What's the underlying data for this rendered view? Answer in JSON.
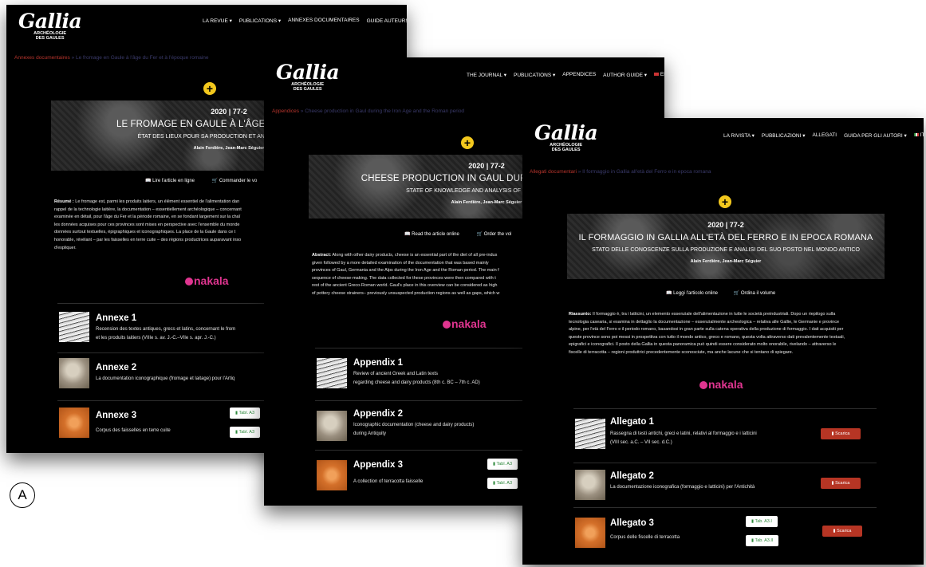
{
  "panel_label": "A",
  "icons": [
    "book-icon",
    "cart-icon",
    "file-icon",
    "plus-icon",
    "flag-icon"
  ],
  "colors": {
    "accent_yellow": "#f3c81d",
    "download_red": "#b63524",
    "nakala_pink": "#e03590",
    "crumb_red": "#b8352d"
  },
  "fr": {
    "logo": {
      "name": "Gallia",
      "sub1": "ARCHÉOLOGIE",
      "sub2": "DES GAULES"
    },
    "nav": [
      "LA REVUE ▾",
      "PUBLICATIONS ▾",
      "ANNEXES DOCUMENTAIRES",
      "GUIDE AUTEURS ▾"
    ],
    "breadcrumb": {
      "root": "Annexes documentaires",
      "current": "» Le fromage en Gaule à l'âge du Fer et à l'époque romaine"
    },
    "hero": {
      "year": "2020 | 77-2",
      "title": "LE FROMAGE EN GAULE À L'ÂGE DU FER ET À L'É",
      "subtitle": "ÉTAT DES LIEUX POUR SA PRODUCTION ET ANALYSE DE SA PLACE",
      "authors": "Alain Ferdière, Jean-Marc Séguier"
    },
    "links": {
      "read": "Lire l'article en ligne",
      "order": "Commander le vo"
    },
    "abstract": {
      "label": "Résumé :",
      "lines": [
        "Le fromage est, parmi les produits laitiers, un élément essentiel de l'alimentation dan",
        "rappel de la technologie laitière, la documentation – essentiellement archéologique – concernant",
        "examinée en détail, pour l'âge du Fer et la période romaine, en se fondant largement sur la chaî",
        "les données acquises pour ces provinces sont mises en perspective avec l'ensemble du monde",
        "données surtout textuelles, épigraphiques et iconographiques. La place de la Gaule dans ce t",
        "honorable, révélant – par les faisselles en terre cuite – des régions productrices auparavant inso",
        "d'expliquer."
      ]
    },
    "nakala": "nakala",
    "rows": [
      {
        "title": "Annexe 1",
        "desc1": "Recension des textes antiques, grecs et latins, concernant le from",
        "desc2": "et les produits laitiers (VIIIe s. av. J.-C.–VIIe s. apr. J.-C.)"
      },
      {
        "title": "Annexe 2",
        "desc1": "La documentation iconographique (fromage et laitage) pour l'Artiq",
        "desc2": ""
      },
      {
        "title": "Annexe 3",
        "desc1": "Corpus des faisselles en terre cuite",
        "desc2": "",
        "btn1": "Tabl. A3",
        "btn2": "Tabl. A3"
      }
    ]
  },
  "en": {
    "logo": {
      "name": "Gallia",
      "sub1": "ARCHÉOLOGIE",
      "sub2": "DES GAULES"
    },
    "nav": [
      "THE JOURNAL ▾",
      "PUBLICATIONS ▾",
      "APPENDICES",
      "AUTHOR GUIDE ▾",
      "EN"
    ],
    "breadcrumb": {
      "root": "Appendices",
      "current": "» Cheese production in Gaul during the Iron Age and the Roman period"
    },
    "hero": {
      "year": "2020 | 77-2",
      "title": "CHEESE PRODUCTION IN GAUL DURING THE IRON AGE",
      "subtitle": "STATE OF KNOWLEDGE AND ANALYSIS OF ITS PLACE IN TH",
      "authors": "Alain Ferdière, Jean-Marc Séguier"
    },
    "links": {
      "read": "Read the article online",
      "order": "Order the vol"
    },
    "abstract": {
      "label": "Abstract:",
      "lines": [
        "Along with other dairy products, cheese is an essential part of the diet of all pre-indus",
        "given followed by a more detailed examination of the documentation that was based mainly",
        "provinces of Gaul, Germania and the Alps during the Iron Age and the Roman period. The main f",
        "sequence of cheese-making. The data collected for these provinces were then compared with t",
        "rest of the ancient Greco-Roman world. Gaul's place in this overview can be considered as high",
        "of pottery cheese strainers– previously unsuspected production regions as well as gaps, which w"
      ]
    },
    "nakala": "nakala",
    "rows": [
      {
        "title": "Appendix 1",
        "desc1": "Review of ancient Greek and Latin texts",
        "desc2": "regarding cheese and dairy products (8th c. BC – 7th c. AD)"
      },
      {
        "title": "Appendix 2",
        "desc1": "Iconographic documentation (cheese and dairy products)",
        "desc2": "during Antiquity"
      },
      {
        "title": "Appendix 3",
        "desc1": "A collection of terracotta faisselle",
        "desc2": "",
        "btn1": "Tabl. A3",
        "btn2": "Tabl. A3"
      }
    ]
  },
  "it": {
    "logo": {
      "name": "Gallia",
      "sub1": "ARCHÉOLOGIE",
      "sub2": "DES GAULES"
    },
    "nav": [
      "LA RIVISTA ▾",
      "PUBBLICAZIONI ▾",
      "ALLEGATI",
      "GUIDA PER GLI AUTORI ▾",
      "IT"
    ],
    "breadcrumb": {
      "root": "Allegati documentari",
      "current": "» Il formaggio in Gallia all'età del Ferro e in epoca romana"
    },
    "hero": {
      "year": "2020 | 77-2",
      "title": "IL FORMAGGIO IN GALLIA ALL'ETÀ DEL FERRO E IN EPOCA ROMANA",
      "subtitle": "STATO DELLE CONOSCENZE SULLA PRODUZIONE E ANALISI DEL SUO POSTO NEL MONDO ANTICO",
      "authors": "Alain Ferdière, Jean-Marc Séguier"
    },
    "links": {
      "read": "Leggi l'articolo online",
      "order": "Ordina il volume"
    },
    "abstract": {
      "label": "Riassunto:",
      "lines": [
        "Il formaggio è, tra i latticini, un elemento essenziale dell'alimentazione in tutte le società preindustriali. Dopo un riepilogo sulla",
        "tecnologia casearia, si esamina in dettaglio la documentazione – essenzialmente archeologica – relativa alle Gallie, le Germanie e province",
        "alpine, per l'età del Ferro e il periodo romano, basandosi in gran parte sulla catena operativa della produzione di formaggio. I dati acquisiti per",
        "queste province sono poi messi in prospettiva con tutto il mondo antico, greco e romano, questa volta attraverso dati prevalentemente testuali,",
        "epigrafici e iconografici. Il posto della Gallia in questa panoramica può quindi essere considerato molto onorabile, rivelando – attraverso le",
        "fiscelle di terracotta – regioni produttrici precedentemente sconosciute, ma anche lacune che si tentano di spiegare."
      ]
    },
    "nakala": "nakala",
    "rows": [
      {
        "title": "Allegato 1",
        "desc1": "Rassegna di testi antichi, greci e latini, relativi al formaggio e i latticini",
        "desc2": "(VIII sec. a.C. – VII sec. d.C.)",
        "btn": "Scarica"
      },
      {
        "title": "Allegato 2",
        "desc1": "La documentazione iconografica (formaggio e latticini) per l'Antichità",
        "desc2": "",
        "btn": "Scarica"
      },
      {
        "title": "Allegato 3",
        "desc1": "Corpus delle fiscelle di terracotta",
        "desc2": "",
        "btn1": "Tab. A3.I",
        "btn2": "Tab. A3.II",
        "btn": "Scarica"
      }
    ]
  }
}
